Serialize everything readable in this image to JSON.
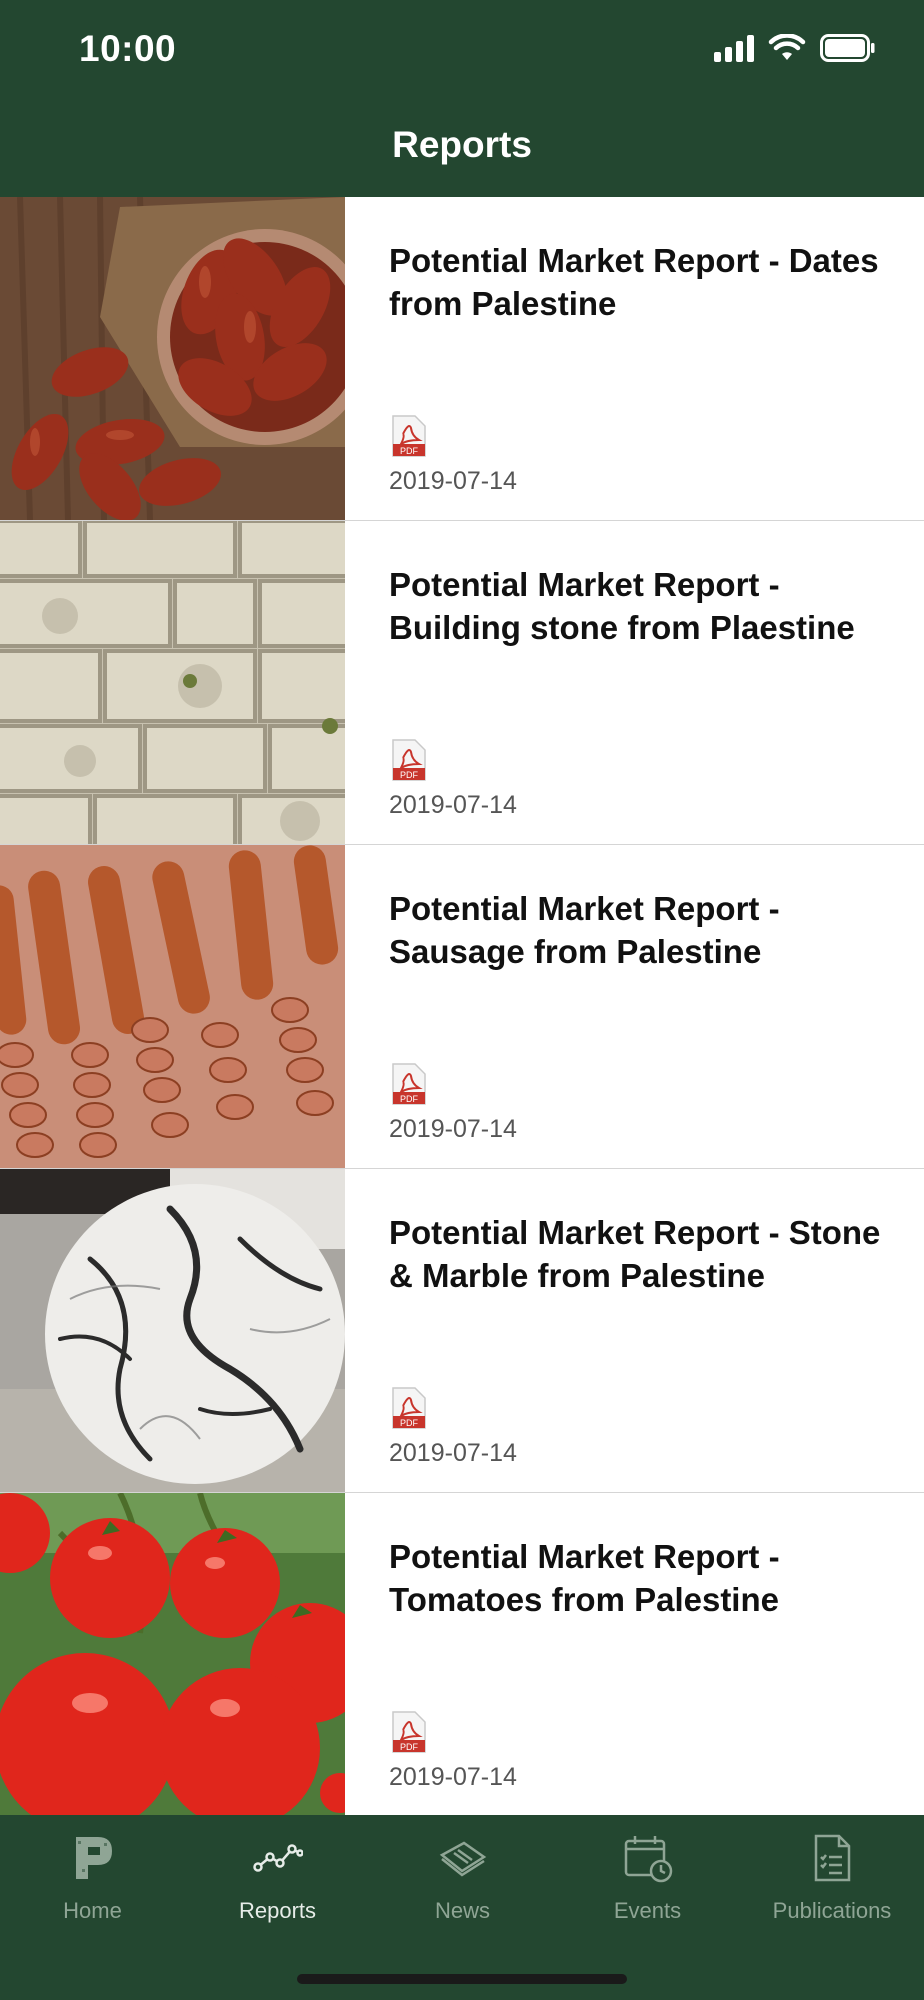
{
  "status": {
    "time": "10:00"
  },
  "header": {
    "title": "Reports"
  },
  "reports": [
    {
      "title": "Potential Market Report - Dates from Palestine",
      "date": "2019-07-14",
      "image": "dates"
    },
    {
      "title": "Potential Market Report - Building stone from Plaestine",
      "date": "2019-07-14",
      "image": "building-stone"
    },
    {
      "title": "Potential Market Report - Sausage from Palestine",
      "date": "2019-07-14",
      "image": "sausage"
    },
    {
      "title": "Potential Market Report - Stone & Marble from Palestine",
      "date": "2019-07-14",
      "image": "marble"
    },
    {
      "title": "Potential Market Report - Tomatoes from Palestine",
      "date": "2019-07-14",
      "image": "tomatoes"
    }
  ],
  "pdf_badge": "PDF",
  "tabs": [
    {
      "label": "Home",
      "icon": "logo-p-icon",
      "active": false
    },
    {
      "label": "Reports",
      "icon": "chart-line-icon",
      "active": true
    },
    {
      "label": "News",
      "icon": "newspaper-icon",
      "active": false
    },
    {
      "label": "Events",
      "icon": "calendar-clock-icon",
      "active": false
    },
    {
      "label": "Publications",
      "icon": "document-list-icon",
      "active": false
    }
  ],
  "colors": {
    "brand_green": "#234730",
    "tab_inactive": "#8fa595",
    "tab_active": "#e6ece8"
  }
}
